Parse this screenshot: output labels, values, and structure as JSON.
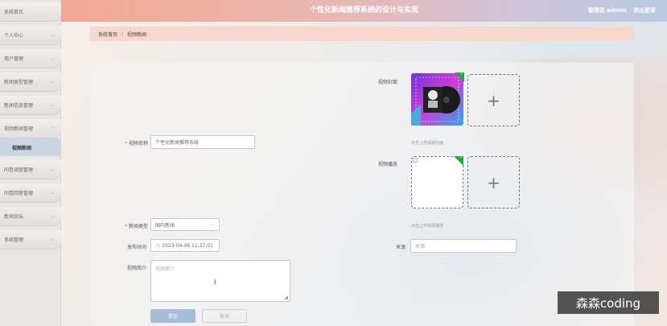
{
  "header": {
    "title": "个性化新闻推荐系统的设计与实现",
    "user_label": "管理员 admin",
    "logout_label": "退出登录"
  },
  "sidebar": {
    "items": [
      {
        "label": "系统首页",
        "has_chevron": false
      },
      {
        "label": "个人中心",
        "has_chevron": true
      },
      {
        "label": "用户管理",
        "has_chevron": true
      },
      {
        "label": "新闻类型管理",
        "has_chevron": true
      },
      {
        "label": "新闻信息管理",
        "has_chevron": true
      },
      {
        "label": "视频新闻管理",
        "has_chevron": true
      },
      {
        "label": "问卷调查管理",
        "has_chevron": true
      },
      {
        "label": "问卷回答管理",
        "has_chevron": true
      },
      {
        "label": "新闻论坛",
        "has_chevron": true
      },
      {
        "label": "系统管理",
        "has_chevron": true
      }
    ],
    "active_sub": "视频新闻"
  },
  "breadcrumb": {
    "home": "系统首页",
    "separator": "/",
    "current": "视频新闻"
  },
  "form": {
    "cover": {
      "label": "视频封面",
      "hint": "点击上传视频封面"
    },
    "name": {
      "label": "视频名称",
      "value": "个性化新闻推荐系统"
    },
    "video": {
      "label": "视频播放",
      "hint": "点击上传视频播放"
    },
    "type": {
      "label": "新闻类型",
      "value": "国内新闻"
    },
    "publish_time": {
      "label": "发布时间",
      "value": "2023-04-06 11:27:01"
    },
    "source": {
      "label": "来源",
      "placeholder": "来源"
    },
    "intro": {
      "label": "视频简介",
      "placeholder": "视频简介"
    },
    "submit_label": "提交",
    "cancel_label": "取消"
  },
  "watermark": "森森coding",
  "colors": {
    "header_start": "#f3a892",
    "header_end": "#b9c9e0",
    "breadcrumb_bg": "#f8d7cc",
    "primary_button": "#a6bcd5",
    "active_menu": "#c9d6e1",
    "required": "#e85b5b",
    "upload_badge": "#27a845"
  }
}
